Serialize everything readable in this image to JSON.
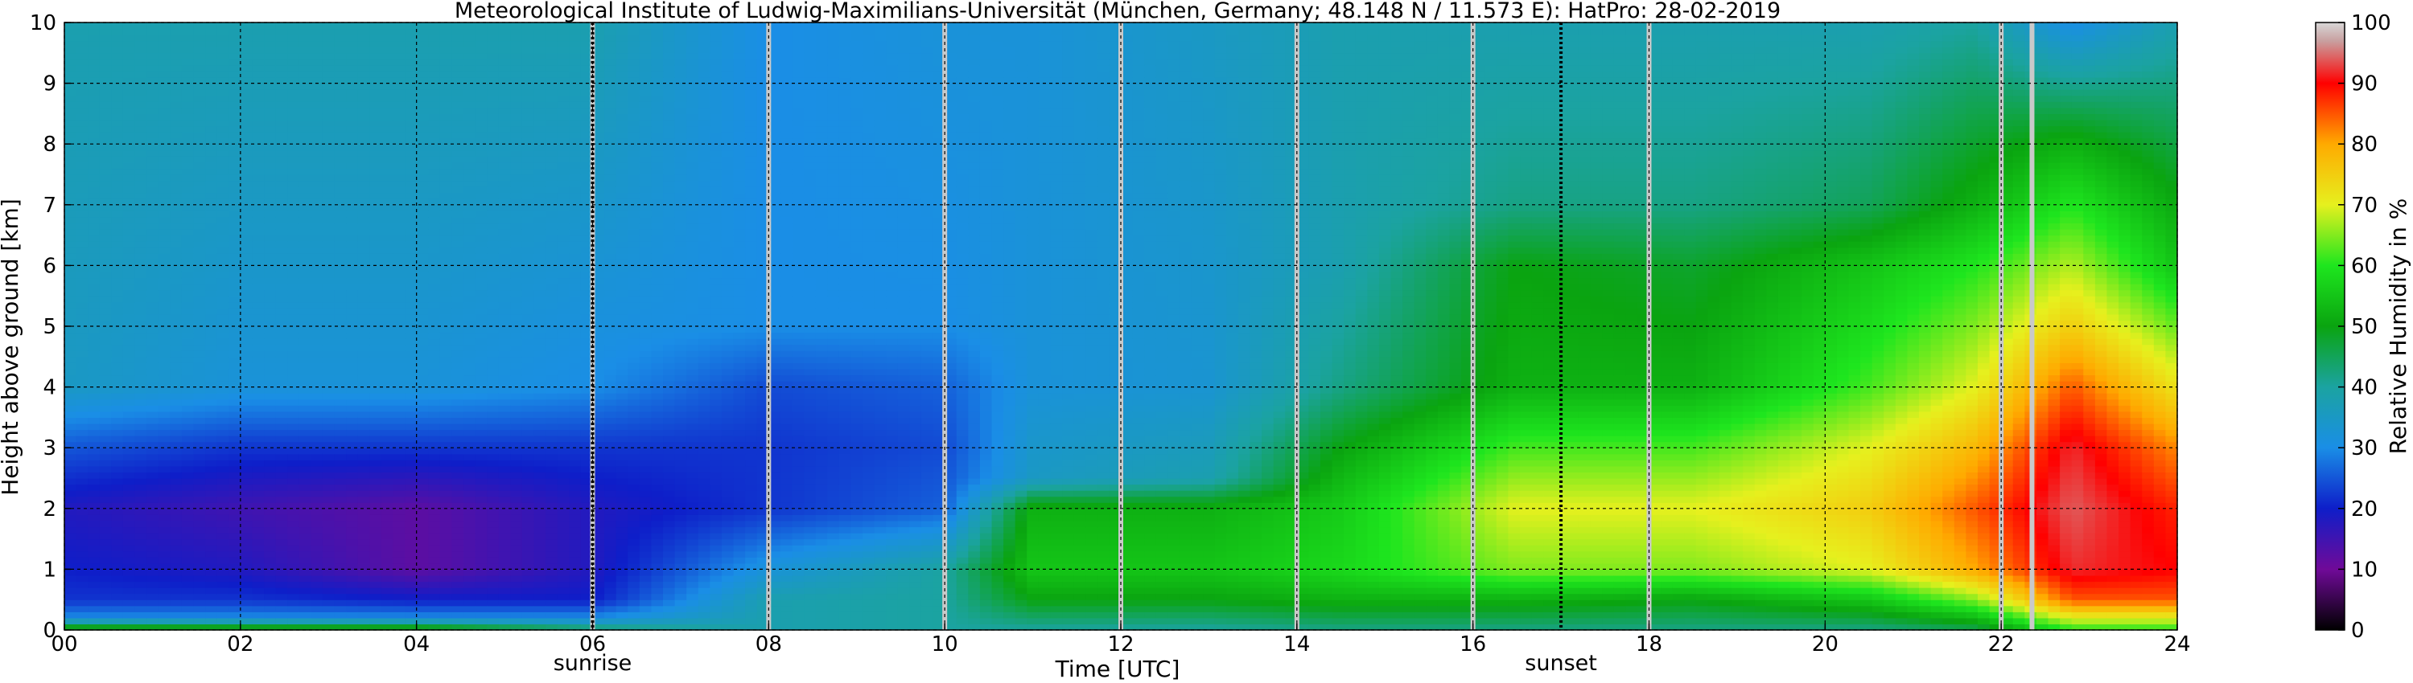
{
  "chart_data": {
    "type": "heatmap",
    "title": "Meteorological Institute of Ludwig-Maximilians-Universität (München, Germany; 48.148 N / 11.573 E):    HatPro: 28-02-2019",
    "xlabel": "Time [UTC]",
    "ylabel": "Height above ground [km]",
    "xlim": [
      0,
      24
    ],
    "ylim": [
      0,
      10
    ],
    "x_ticks": [
      "00",
      "02",
      "04",
      "06",
      "08",
      "10",
      "12",
      "14",
      "16",
      "18",
      "20",
      "22",
      "24"
    ],
    "y_ticks": [
      "0",
      "1",
      "2",
      "3",
      "4",
      "5",
      "6",
      "7",
      "8",
      "9",
      "10"
    ],
    "grid": true,
    "annotations": [
      {
        "label": "sunrise",
        "time": 6.0
      },
      {
        "label": "sunset",
        "time": 17.0
      }
    ],
    "scan_gaps_utc": [
      6.0,
      8.0,
      10.0,
      12.0,
      14.0,
      16.0,
      18.0,
      22.0,
      22.35
    ],
    "colorbar": {
      "label": "Relative Humidity in %",
      "range": [
        0,
        100
      ],
      "ticks": [
        "0",
        "10",
        "20",
        "30",
        "40",
        "50",
        "60",
        "70",
        "80",
        "90",
        "100"
      ],
      "stops": [
        {
          "v": 0,
          "c": "#000000"
        },
        {
          "v": 10,
          "c": "#700a98"
        },
        {
          "v": 20,
          "c": "#0e1ec9"
        },
        {
          "v": 30,
          "c": "#1a8ee6"
        },
        {
          "v": 40,
          "c": "#1ba3a1"
        },
        {
          "v": 50,
          "c": "#0aa410"
        },
        {
          "v": 60,
          "c": "#1ee61e"
        },
        {
          "v": 70,
          "c": "#e6f01e"
        },
        {
          "v": 80,
          "c": "#ffaa00"
        },
        {
          "v": 90,
          "c": "#ff0000"
        },
        {
          "v": 97,
          "c": "#c8a0a0"
        },
        {
          "v": 100,
          "c": "#d8d8d8"
        }
      ]
    },
    "profiles": [
      {
        "t": 0.0,
        "h": [
          0,
          0.2,
          0.5,
          1.0,
          2.0,
          3.0,
          4.0,
          10
        ],
        "rh": [
          55,
          30,
          22,
          20,
          18,
          25,
          35,
          38
        ]
      },
      {
        "t": 2.0,
        "h": [
          0,
          0.2,
          0.5,
          1.0,
          2.0,
          3.0,
          4.0,
          10
        ],
        "rh": [
          55,
          30,
          22,
          18,
          15,
          22,
          32,
          38
        ]
      },
      {
        "t": 4.0,
        "h": [
          0,
          0.2,
          0.5,
          1.0,
          2.0,
          3.0,
          4.0,
          10
        ],
        "rh": [
          55,
          30,
          20,
          12,
          12,
          22,
          32,
          38
        ]
      },
      {
        "t": 6.0,
        "h": [
          0,
          0.2,
          0.5,
          1.0,
          2.0,
          3.0,
          4.0,
          10
        ],
        "rh": [
          45,
          30,
          20,
          18,
          18,
          22,
          30,
          38
        ]
      },
      {
        "t": 8.0,
        "h": [
          0,
          0.5,
          1.0,
          2.0,
          3.0,
          4.0,
          5.0,
          10
        ],
        "rh": [
          38,
          38,
          32,
          22,
          22,
          24,
          30,
          30
        ]
      },
      {
        "t": 10.0,
        "h": [
          0,
          1.0,
          2.0,
          3.0,
          4.0,
          5.0,
          10
        ],
        "rh": [
          40,
          40,
          26,
          24,
          26,
          30,
          32
        ]
      },
      {
        "t": 11.0,
        "h": [
          0,
          0.5,
          1.0,
          2.0,
          2.5,
          4.0,
          10
        ],
        "rh": [
          40,
          50,
          55,
          52,
          35,
          32,
          32
        ]
      },
      {
        "t": 13.0,
        "h": [
          0,
          0.5,
          1.0,
          2.0,
          2.5,
          4.0,
          10
        ],
        "rh": [
          40,
          50,
          55,
          52,
          38,
          33,
          35
        ]
      },
      {
        "t": 14.5,
        "h": [
          0,
          0.5,
          1.0,
          2.0,
          3.0,
          4.0,
          6.0,
          10
        ],
        "rh": [
          42,
          52,
          58,
          56,
          50,
          42,
          38,
          38
        ]
      },
      {
        "t": 16.5,
        "h": [
          0,
          0.5,
          1.0,
          2.0,
          3.0,
          4.0,
          6.0,
          7.0,
          10
        ],
        "rh": [
          42,
          52,
          65,
          70,
          62,
          52,
          50,
          42,
          38
        ]
      },
      {
        "t": 18.5,
        "h": [
          0,
          0.5,
          1.0,
          2.0,
          3.0,
          4.0,
          6.0,
          7.0,
          10
        ],
        "rh": [
          42,
          50,
          65,
          70,
          62,
          52,
          48,
          42,
          38
        ]
      },
      {
        "t": 20.5,
        "h": [
          0,
          0.5,
          1.0,
          2.0,
          3.0,
          4.0,
          6.0,
          7.0,
          10
        ],
        "rh": [
          42,
          55,
          70,
          75,
          70,
          62,
          55,
          45,
          38
        ]
      },
      {
        "t": 21.7,
        "h": [
          0,
          0.5,
          1.0,
          2.0,
          3.0,
          4.0,
          6.0,
          7.0,
          10
        ],
        "rh": [
          45,
          65,
          80,
          85,
          78,
          70,
          60,
          52,
          40
        ]
      },
      {
        "t": 22.8,
        "h": [
          0,
          0.5,
          1.0,
          2.0,
          3.0,
          4.0,
          5.0,
          7.0,
          8.0,
          10
        ],
        "rh": [
          60,
          85,
          92,
          94,
          92,
          85,
          75,
          60,
          52,
          30
        ]
      },
      {
        "t": 24.0,
        "h": [
          0,
          0.5,
          1.0,
          2.0,
          3.0,
          4.0,
          6.0,
          10
        ],
        "rh": [
          60,
          85,
          90,
          88,
          82,
          72,
          55,
          38
        ]
      }
    ]
  }
}
